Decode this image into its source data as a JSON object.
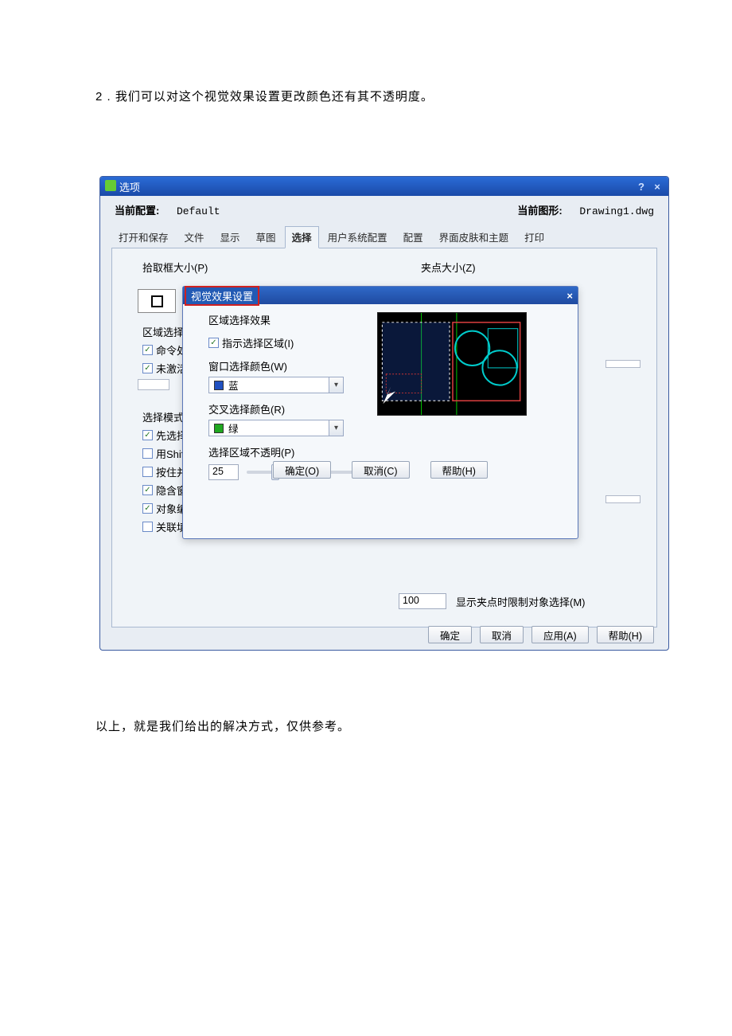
{
  "doc": {
    "intro": "2 . 我们可以对这个视觉效果设置更改颜色还有其不透明度。",
    "outro": "以上，就是我们给出的解决方式，仅供参考。"
  },
  "options_window": {
    "title": "选项",
    "profile_label": "当前配置:",
    "profile_value": "Default",
    "drawing_label": "当前图形:",
    "drawing_value": "Drawing1.dwg",
    "tabs": [
      "打开和保存",
      "文件",
      "显示",
      "草图",
      "选择",
      "用户系统配置",
      "配置",
      "界面皮肤和主题",
      "打印"
    ],
    "active_tab_index": 4,
    "left": {
      "pick_label": "拾取框大小(P)",
      "area_effect": "区域选择效",
      "cb_command": "命令处",
      "cb_inactive": "未激活",
      "select_mode": "选择模式",
      "cb_presel": "先选择",
      "cb_shift": "用Shif",
      "cb_hold": "按住并",
      "cb_hideimp": "隐含窗",
      "cb_objedit": "对象编",
      "cb_assocfill": "关联填充(V)"
    },
    "right": {
      "grip_label": "夹点大小(Z)",
      "limit_value": "100",
      "limit_label": "显示夹点时限制对象选择(M)"
    },
    "footer": {
      "ok": "确定",
      "cancel": "取消",
      "apply": "应用(A)",
      "help": "帮助(H)"
    }
  },
  "ve_dialog": {
    "title": "视觉效果设置",
    "group_title": "区域选择效果",
    "cb_indicate": "指示选择区域(I)",
    "win_color_label": "窗口选择颜色(W)",
    "win_color_value": "蓝",
    "win_color_hex": "#2050c0",
    "cross_color_label": "交叉选择颜色(R)",
    "cross_color_value": "绿",
    "cross_color_hex": "#20a820",
    "opacity_label": "选择区域不透明(P)",
    "opacity_value": "25",
    "buttons": {
      "ok": "确定(O)",
      "cancel": "取消(C)",
      "help": "帮助(H)"
    }
  }
}
